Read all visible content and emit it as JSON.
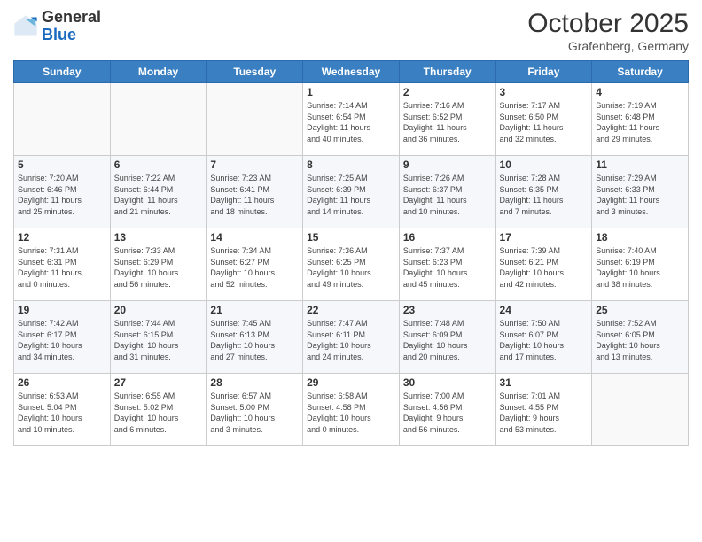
{
  "header": {
    "logo_general": "General",
    "logo_blue": "Blue",
    "month_year": "October 2025",
    "location": "Grafenberg, Germany"
  },
  "weekdays": [
    "Sunday",
    "Monday",
    "Tuesday",
    "Wednesday",
    "Thursday",
    "Friday",
    "Saturday"
  ],
  "weeks": [
    [
      {
        "day": "",
        "info": ""
      },
      {
        "day": "",
        "info": ""
      },
      {
        "day": "",
        "info": ""
      },
      {
        "day": "1",
        "info": "Sunrise: 7:14 AM\nSunset: 6:54 PM\nDaylight: 11 hours\nand 40 minutes."
      },
      {
        "day": "2",
        "info": "Sunrise: 7:16 AM\nSunset: 6:52 PM\nDaylight: 11 hours\nand 36 minutes."
      },
      {
        "day": "3",
        "info": "Sunrise: 7:17 AM\nSunset: 6:50 PM\nDaylight: 11 hours\nand 32 minutes."
      },
      {
        "day": "4",
        "info": "Sunrise: 7:19 AM\nSunset: 6:48 PM\nDaylight: 11 hours\nand 29 minutes."
      }
    ],
    [
      {
        "day": "5",
        "info": "Sunrise: 7:20 AM\nSunset: 6:46 PM\nDaylight: 11 hours\nand 25 minutes."
      },
      {
        "day": "6",
        "info": "Sunrise: 7:22 AM\nSunset: 6:44 PM\nDaylight: 11 hours\nand 21 minutes."
      },
      {
        "day": "7",
        "info": "Sunrise: 7:23 AM\nSunset: 6:41 PM\nDaylight: 11 hours\nand 18 minutes."
      },
      {
        "day": "8",
        "info": "Sunrise: 7:25 AM\nSunset: 6:39 PM\nDaylight: 11 hours\nand 14 minutes."
      },
      {
        "day": "9",
        "info": "Sunrise: 7:26 AM\nSunset: 6:37 PM\nDaylight: 11 hours\nand 10 minutes."
      },
      {
        "day": "10",
        "info": "Sunrise: 7:28 AM\nSunset: 6:35 PM\nDaylight: 11 hours\nand 7 minutes."
      },
      {
        "day": "11",
        "info": "Sunrise: 7:29 AM\nSunset: 6:33 PM\nDaylight: 11 hours\nand 3 minutes."
      }
    ],
    [
      {
        "day": "12",
        "info": "Sunrise: 7:31 AM\nSunset: 6:31 PM\nDaylight: 11 hours\nand 0 minutes."
      },
      {
        "day": "13",
        "info": "Sunrise: 7:33 AM\nSunset: 6:29 PM\nDaylight: 10 hours\nand 56 minutes."
      },
      {
        "day": "14",
        "info": "Sunrise: 7:34 AM\nSunset: 6:27 PM\nDaylight: 10 hours\nand 52 minutes."
      },
      {
        "day": "15",
        "info": "Sunrise: 7:36 AM\nSunset: 6:25 PM\nDaylight: 10 hours\nand 49 minutes."
      },
      {
        "day": "16",
        "info": "Sunrise: 7:37 AM\nSunset: 6:23 PM\nDaylight: 10 hours\nand 45 minutes."
      },
      {
        "day": "17",
        "info": "Sunrise: 7:39 AM\nSunset: 6:21 PM\nDaylight: 10 hours\nand 42 minutes."
      },
      {
        "day": "18",
        "info": "Sunrise: 7:40 AM\nSunset: 6:19 PM\nDaylight: 10 hours\nand 38 minutes."
      }
    ],
    [
      {
        "day": "19",
        "info": "Sunrise: 7:42 AM\nSunset: 6:17 PM\nDaylight: 10 hours\nand 34 minutes."
      },
      {
        "day": "20",
        "info": "Sunrise: 7:44 AM\nSunset: 6:15 PM\nDaylight: 10 hours\nand 31 minutes."
      },
      {
        "day": "21",
        "info": "Sunrise: 7:45 AM\nSunset: 6:13 PM\nDaylight: 10 hours\nand 27 minutes."
      },
      {
        "day": "22",
        "info": "Sunrise: 7:47 AM\nSunset: 6:11 PM\nDaylight: 10 hours\nand 24 minutes."
      },
      {
        "day": "23",
        "info": "Sunrise: 7:48 AM\nSunset: 6:09 PM\nDaylight: 10 hours\nand 20 minutes."
      },
      {
        "day": "24",
        "info": "Sunrise: 7:50 AM\nSunset: 6:07 PM\nDaylight: 10 hours\nand 17 minutes."
      },
      {
        "day": "25",
        "info": "Sunrise: 7:52 AM\nSunset: 6:05 PM\nDaylight: 10 hours\nand 13 minutes."
      }
    ],
    [
      {
        "day": "26",
        "info": "Sunrise: 6:53 AM\nSunset: 5:04 PM\nDaylight: 10 hours\nand 10 minutes."
      },
      {
        "day": "27",
        "info": "Sunrise: 6:55 AM\nSunset: 5:02 PM\nDaylight: 10 hours\nand 6 minutes."
      },
      {
        "day": "28",
        "info": "Sunrise: 6:57 AM\nSunset: 5:00 PM\nDaylight: 10 hours\nand 3 minutes."
      },
      {
        "day": "29",
        "info": "Sunrise: 6:58 AM\nSunset: 4:58 PM\nDaylight: 10 hours\nand 0 minutes."
      },
      {
        "day": "30",
        "info": "Sunrise: 7:00 AM\nSunset: 4:56 PM\nDaylight: 9 hours\nand 56 minutes."
      },
      {
        "day": "31",
        "info": "Sunrise: 7:01 AM\nSunset: 4:55 PM\nDaylight: 9 hours\nand 53 minutes."
      },
      {
        "day": "",
        "info": ""
      }
    ]
  ]
}
